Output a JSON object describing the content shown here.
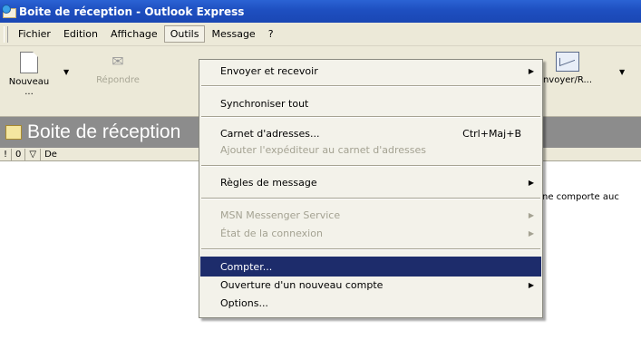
{
  "window": {
    "title": "Boite de réception - Outlook Express"
  },
  "menubar": {
    "items": [
      "Fichier",
      "Edition",
      "Affichage",
      "Outils",
      "Message",
      "?"
    ],
    "active": "Outils"
  },
  "toolbar": {
    "new_label": "Nouveau ...",
    "reply_label": "Répondre",
    "send_label": "nvoyer/R..."
  },
  "folder": {
    "title": "Boite de réception"
  },
  "columns": [
    "!",
    "0",
    "▽",
    "De"
  ],
  "list": {
    "partial_text": "ne comporte auc"
  },
  "dropdown": {
    "items": [
      {
        "label": "Envoyer et recevoir",
        "submenu": true
      },
      {
        "label": "Synchroniser tout"
      },
      {
        "label": "Carnet d'adresses...",
        "shortcut": "Ctrl+Maj+B"
      },
      {
        "label": "Ajouter l'expéditeur au carnet d'adresses",
        "disabled": true
      },
      {
        "label": "Règles de message",
        "submenu": true
      },
      {
        "label": "MSN Messenger Service",
        "submenu": true,
        "disabled": true
      },
      {
        "label": "État de la connexion",
        "submenu": true,
        "disabled": true
      },
      {
        "label": "Compter...",
        "highlighted": true
      },
      {
        "label": "Ouverture d'un nouveau compte",
        "submenu": true
      },
      {
        "label": "Options..."
      }
    ]
  },
  "colors": {
    "titlebar": "#1e4fc0",
    "menu_highlight": "#1d2c6b",
    "folderbar": "#8c8c8c",
    "chrome": "#ece9d8"
  }
}
